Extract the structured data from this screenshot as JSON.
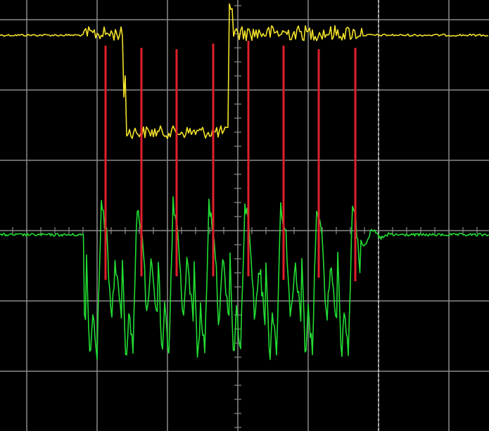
{
  "display": {
    "background": "#000000",
    "grid_color": "#8a8a8a",
    "grid_divisions": {
      "horizontal": 7,
      "vertical": 6
    },
    "center_axis_ticks": true,
    "trigger_marker_color": "#cfcfcf"
  },
  "channels": [
    {
      "id": "ch1",
      "color": "#f2e22a",
      "shape": "square-pulse-high-low-high"
    },
    {
      "id": "ch2",
      "color": "#22dc33",
      "shape": "oscillating-burst"
    }
  ],
  "markers": {
    "color": "#e0202a",
    "count": 8
  }
}
